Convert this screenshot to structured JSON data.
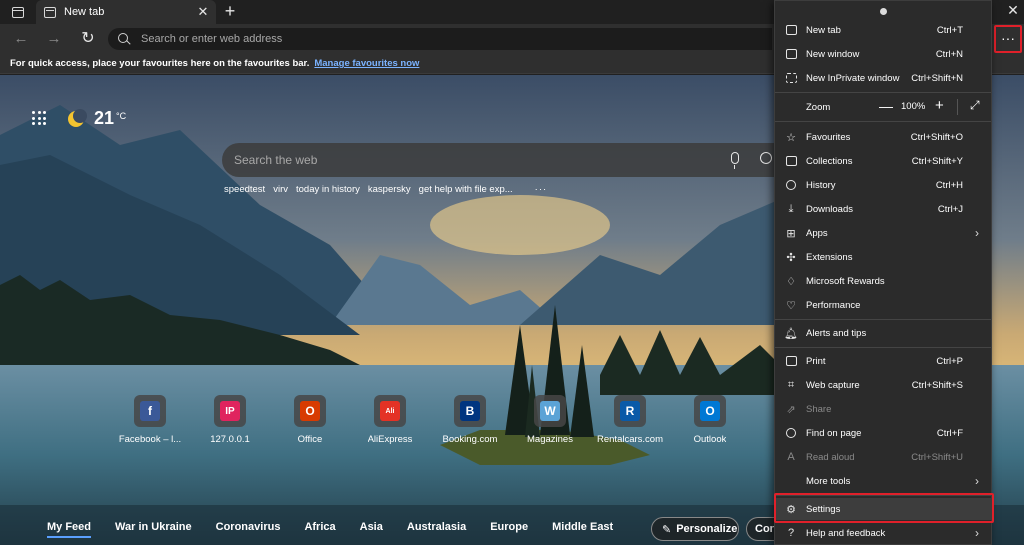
{
  "tab": {
    "title": "New tab",
    "close": "✕"
  },
  "new_tab_button": "+",
  "window_close": "✕",
  "toolbar": {
    "back": "←",
    "forward": "→",
    "refresh": "↻",
    "address_placeholder": "Search or enter web address",
    "more": "···"
  },
  "favbar": {
    "message": "For quick access, place your favourites here on the favourites bar.",
    "link": "Manage favourites now"
  },
  "weather": {
    "temp": "21",
    "unit": "°C"
  },
  "ntp_search": {
    "placeholder": "Search the web"
  },
  "suggestions": [
    "speedtest",
    "virv",
    "today in history",
    "kaspersky",
    "get help with file exp..."
  ],
  "suggestions_more": "···",
  "quick_links": [
    {
      "label": "Facebook – l...",
      "glyph": "f",
      "color": "#3b5998"
    },
    {
      "label": "127.0.0.1",
      "glyph": "IP",
      "color": "#e0245e"
    },
    {
      "label": "Office",
      "glyph": "O",
      "color": "#d83b01"
    },
    {
      "label": "AliExpress",
      "glyph": "Ali",
      "color": "#e43225"
    },
    {
      "label": "Booking.com",
      "glyph": "B",
      "color": "#003580"
    },
    {
      "label": "Magazines",
      "glyph": "W",
      "color": "#5ba3d6"
    },
    {
      "label": "Rentalcars.com",
      "glyph": "R",
      "color": "#0a5aa8"
    },
    {
      "label": "Outlook",
      "glyph": "O",
      "color": "#0078d4"
    }
  ],
  "feed_nav": [
    "My Feed",
    "War in Ukraine",
    "Coronavirus",
    "Africa",
    "Asia",
    "Australasia",
    "Europe",
    "Middle East"
  ],
  "personalize": "Personalize",
  "con_button": "Con",
  "menu": {
    "new_tab": {
      "label": "New tab",
      "shortcut": "Ctrl+T"
    },
    "new_window": {
      "label": "New window",
      "shortcut": "Ctrl+N"
    },
    "new_inprivate": {
      "label": "New InPrivate window",
      "shortcut": "Ctrl+Shift+N"
    },
    "zoom": {
      "label": "Zoom",
      "minus": "—",
      "value": "100%",
      "plus": "+",
      "fullscreen": "⤢"
    },
    "favourites": {
      "label": "Favourites",
      "shortcut": "Ctrl+Shift+O"
    },
    "collections": {
      "label": "Collections",
      "shortcut": "Ctrl+Shift+Y"
    },
    "history": {
      "label": "History",
      "shortcut": "Ctrl+H"
    },
    "downloads": {
      "label": "Downloads",
      "shortcut": "Ctrl+J"
    },
    "apps": {
      "label": "Apps"
    },
    "extensions": {
      "label": "Extensions"
    },
    "rewards": {
      "label": "Microsoft Rewards"
    },
    "performance": {
      "label": "Performance"
    },
    "alerts": {
      "label": "Alerts and tips"
    },
    "print": {
      "label": "Print",
      "shortcut": "Ctrl+P"
    },
    "web_capture": {
      "label": "Web capture",
      "shortcut": "Ctrl+Shift+S"
    },
    "share": {
      "label": "Share"
    },
    "find": {
      "label": "Find on page",
      "shortcut": "Ctrl+F"
    },
    "read_aloud": {
      "label": "Read aloud",
      "shortcut": "Ctrl+Shift+U"
    },
    "more_tools": {
      "label": "More tools"
    },
    "settings": {
      "label": "Settings"
    },
    "help": {
      "label": "Help and feedback"
    }
  },
  "colors": {
    "highlight": "#e0202a",
    "link": "#7bb3ff",
    "menu_bg": "#2b2b2b"
  }
}
